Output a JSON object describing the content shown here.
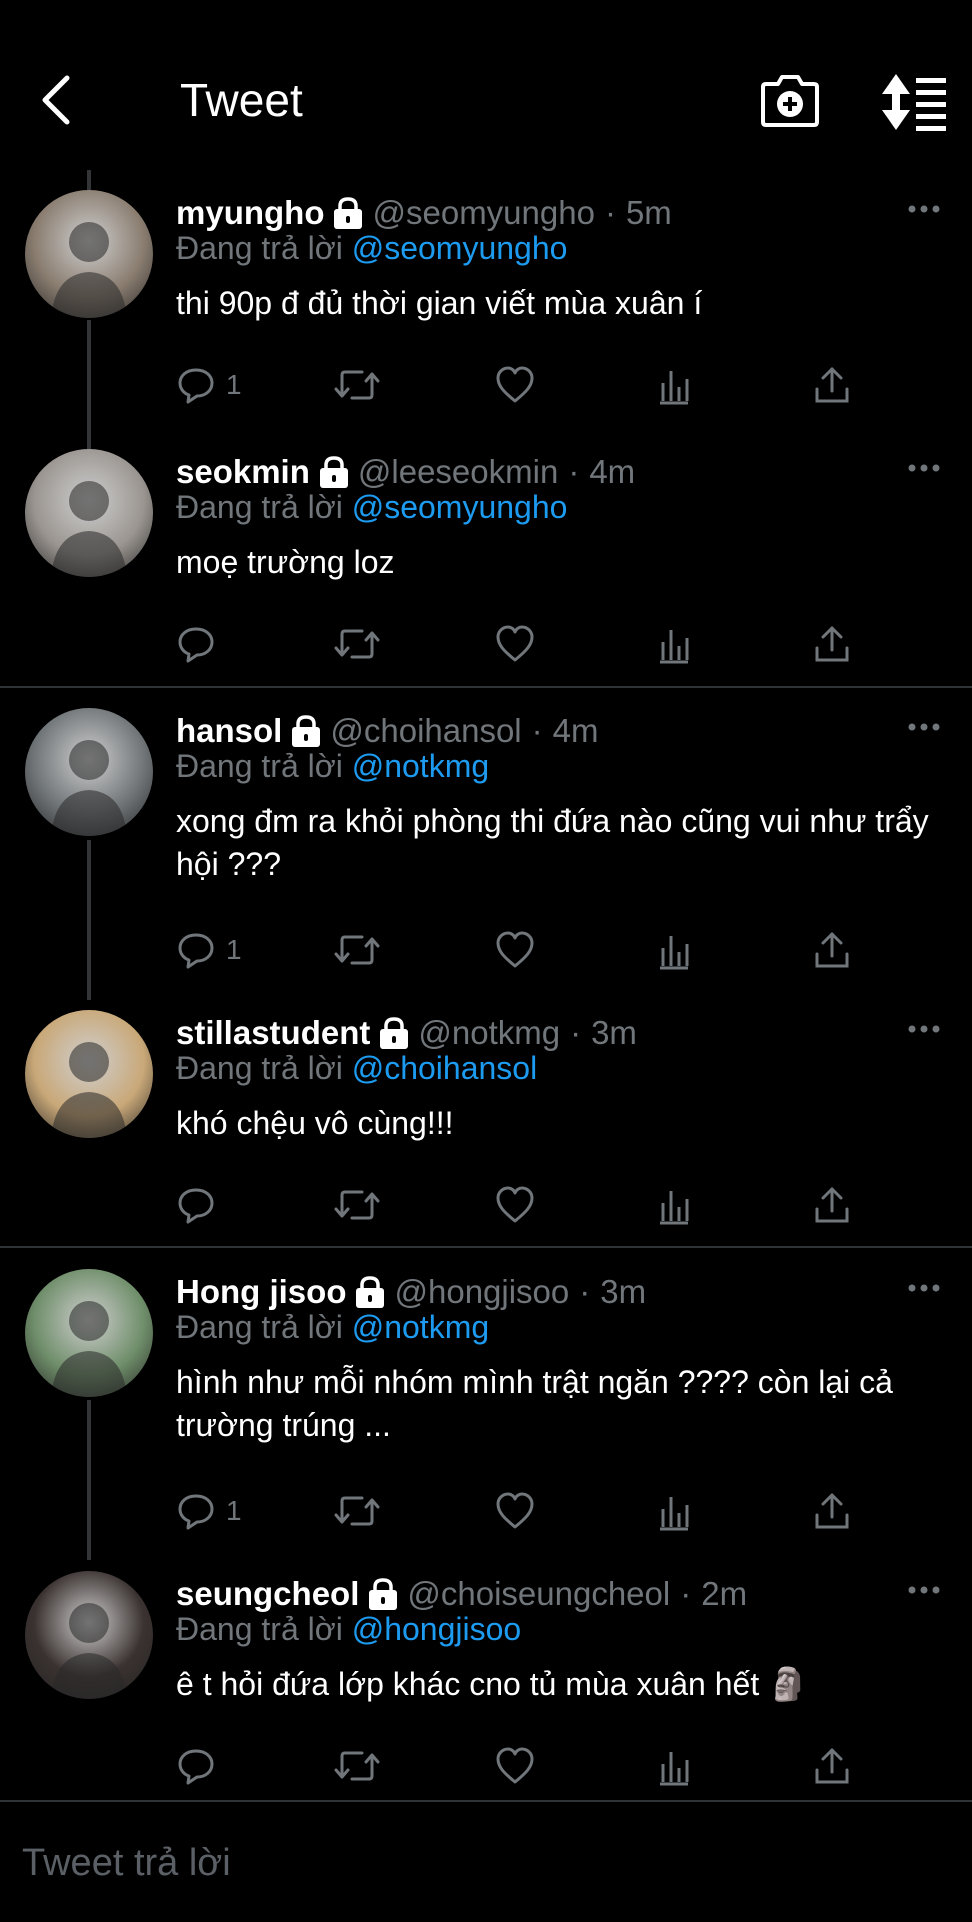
{
  "header": {
    "title": "Tweet",
    "back_icon": "chevron-left-icon",
    "camera_icon": "camera-plus-icon",
    "sort_icon": "sort-icon"
  },
  "reply_prefix": "Đang trả lời",
  "tweets": [
    {
      "name": "myungho",
      "handle": "@seomyungho",
      "sep": "·",
      "time": "5m",
      "reply_to": "@seomyungho",
      "text": "thi 90p đ đủ thời gian viết mùa xuân í",
      "reply_count": "1",
      "avatar_color": "#8a7d70"
    },
    {
      "name": "seokmin",
      "handle": "@leeseokmin",
      "sep": "·",
      "time": "4m",
      "reply_to": "@seomyungho",
      "text": "moẹ trường loz",
      "reply_count": "",
      "avatar_color": "#9a9590"
    },
    {
      "name": "hansol",
      "handle": "@choihansol",
      "sep": "·",
      "time": "4m",
      "reply_to": "@notkmg",
      "text": "xong đm ra khỏi phòng thi đứa nào cũng vui như trẩy hội ???",
      "reply_count": "1",
      "avatar_color": "#707578"
    },
    {
      "name": "stillastudent",
      "handle": "@notkmg",
      "sep": "·",
      "time": "3m",
      "reply_to": "@choihansol",
      "text": "khó chệu vô cùng!!!",
      "reply_count": "",
      "avatar_color": "#c9a878"
    },
    {
      "name": "Hong jisoo",
      "handle": "@hongjisoo",
      "sep": "·",
      "time": "3m",
      "reply_to": "@notkmg",
      "text": "hình như mỗi nhóm mình trật ngăn ???? còn lại cả trường trúng ...",
      "reply_count": "1",
      "avatar_color": "#6f8e6a"
    },
    {
      "name": "seungcheol",
      "handle": "@choiseungcheol",
      "sep": "·",
      "time": "2m",
      "reply_to": "@hongjisoo",
      "text": "ê t hỏi đứa lớp khác cno tủ mùa xuân hết 🗿",
      "reply_count": "",
      "avatar_color": "#3a3230"
    }
  ],
  "reply_bar": {
    "placeholder": "Tweet trả lời"
  },
  "colors": {
    "background": "#000000",
    "link": "#1d9bf0",
    "muted": "#71767b",
    "divider": "#2f3336"
  }
}
